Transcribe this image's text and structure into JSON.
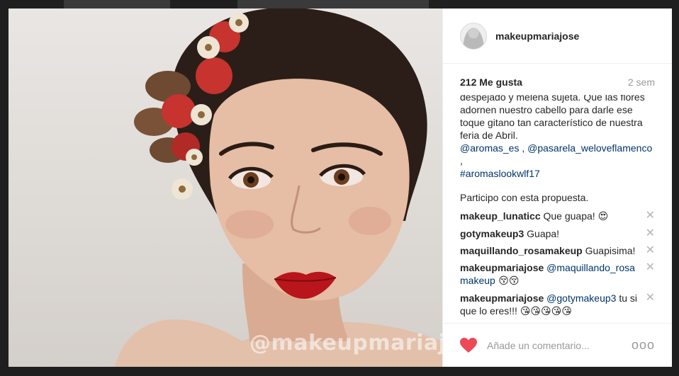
{
  "post": {
    "username": "makeupmariajose",
    "likes": "212 Me gusta",
    "time_ago": "2 sem",
    "watermark": "@makeupmariajose"
  },
  "caption": {
    "lines": [
      "despejado y melena sujeta. Que las flores",
      "adornen nuestro cabello para darle ese",
      "toque gitano tan característico de nuestra",
      "feria de Abril."
    ],
    "mention_1": "@aromas_es",
    "separator": " , ",
    "mention_2": "@pasarela_weloveflamenco",
    "trailing": " ,",
    "hashtag": "#aromaslookwlf17",
    "note": "Participo con esta propuesta."
  },
  "comments": [
    {
      "author": "makeup_lunaticc",
      "text": " Que guapa! ",
      "emoji": "😍"
    },
    {
      "author": "gotymakeup3",
      "text": " Guapa!"
    },
    {
      "author": "maquillando_rosamakeup",
      "text": " Guapisima!"
    },
    {
      "author": "makeupmariajose",
      "mention": " @maquillando_rosa makeup",
      "emoji": " 😚😚"
    },
    {
      "author": "makeupmariajose",
      "mention": " @gotymakeup3",
      "text": " tu si que lo eres!!! ",
      "emoji": "😘😘😘😘😘"
    }
  ],
  "actions": {
    "comment_placeholder": "Añade un comentario...",
    "more_label": "ooo",
    "remove_symbol": "✕",
    "heart_color": "#ed4956"
  }
}
